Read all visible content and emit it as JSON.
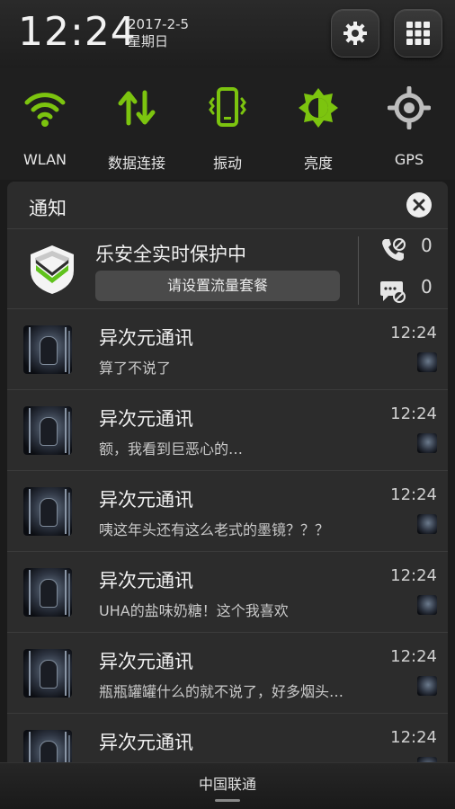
{
  "status": {
    "time": "12:24",
    "date": "2017-2-5",
    "weekday": "星期日"
  },
  "header_buttons": {
    "settings_icon": "gear-icon",
    "apps_icon": "grid-icon"
  },
  "toggles": [
    {
      "label": "WLAN",
      "icon": "wifi-icon",
      "active": true
    },
    {
      "label": "数据连接",
      "icon": "data-sync-icon",
      "active": true
    },
    {
      "label": "振动",
      "icon": "vibrate-icon",
      "active": true
    },
    {
      "label": "亮度",
      "icon": "brightness-icon",
      "active": true
    },
    {
      "label": "GPS",
      "icon": "gps-icon",
      "active": false
    }
  ],
  "colors": {
    "accent_green": "#7cc40f",
    "inactive_gray": "#bdbdbd",
    "panel_bg": "#2c2c2c"
  },
  "notifications": {
    "title": "通知",
    "security": {
      "title": "乐安全实时保护中",
      "button": "请设置流量套餐",
      "blocked_calls": "0",
      "blocked_sms": "0"
    },
    "messages": [
      {
        "title": "异次元通讯",
        "text": "算了不说了",
        "time": "12:24"
      },
      {
        "title": "异次元通讯",
        "text": "额，我看到巨恶心的…",
        "time": "12:24"
      },
      {
        "title": "异次元通讯",
        "text": "咦这年头还有这么老式的墨镜？？？",
        "time": "12:24"
      },
      {
        "title": "异次元通讯",
        "text": "UHA的盐味奶糖！这个我喜欢",
        "time": "12:24"
      },
      {
        "title": "异次元通讯",
        "text": "瓶瓶罐罐什么的就不说了，好多烟头…",
        "time": "12:24"
      },
      {
        "title": "异次元通讯",
        "text": "",
        "time": "12:24"
      }
    ]
  },
  "footer": {
    "carrier": "中国联通"
  }
}
